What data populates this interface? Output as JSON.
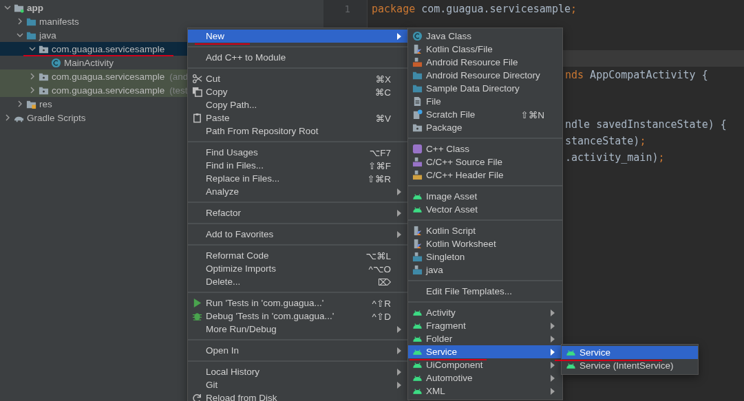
{
  "project_tree": [
    {
      "label": "app",
      "kind": "module",
      "expanded": true,
      "selected": false,
      "test": false,
      "underlined": false,
      "children": [
        {
          "label": "manifests",
          "kind": "folder",
          "expanded": false,
          "selected": false,
          "test": false,
          "underlined": false
        },
        {
          "label": "java",
          "kind": "folder",
          "expanded": true,
          "selected": false,
          "test": false,
          "underlined": false,
          "children": [
            {
              "label": "com.guagua.servicesample",
              "kind": "package",
              "expanded": true,
              "selected": true,
              "test": false,
              "underlined": true,
              "children": [
                {
                  "label": "MainActivity",
                  "kind": "java-class",
                  "selected": false,
                  "test": false,
                  "underlined": false
                }
              ]
            },
            {
              "label": "com.guagua.servicesample",
              "suffix": "(and",
              "kind": "package",
              "expanded": false,
              "selected": false,
              "test": true,
              "underlined": false
            },
            {
              "label": "com.guagua.servicesample",
              "suffix": "(test",
              "kind": "package",
              "expanded": false,
              "selected": false,
              "test": true,
              "underlined": false
            }
          ]
        },
        {
          "label": "res",
          "kind": "res-folder",
          "expanded": false,
          "selected": false,
          "test": false,
          "underlined": false
        }
      ]
    },
    {
      "label": "Gradle Scripts",
      "kind": "gradle",
      "expanded": false,
      "selected": false,
      "test": false,
      "underlined": false
    }
  ],
  "editor": {
    "lines": [
      {
        "number": "1",
        "kind": "full",
        "current": false,
        "tokens": [
          {
            "text": "package",
            "kind": "keyword"
          },
          {
            "text": " com.guagua.servicesample",
            "kind": "plain"
          },
          {
            "text": ";",
            "kind": "keyword"
          }
        ]
      },
      {
        "kind": "full",
        "current": false
      },
      {
        "kind": "covered",
        "current": false
      },
      {
        "kind": "covered",
        "current": true
      },
      {
        "kind": "covered",
        "current": false,
        "tokens": [
          {
            "text": "nds",
            "kind": "keyword"
          },
          {
            "text": " AppCompatActivity {",
            "kind": "plain"
          }
        ]
      },
      {
        "kind": "covered",
        "current": false
      },
      {
        "kind": "covered",
        "current": false
      },
      {
        "kind": "covered",
        "current": false,
        "tokens": [
          {
            "text": "ndle savedInstanceState) {",
            "kind": "plain"
          }
        ]
      },
      {
        "kind": "covered",
        "current": false,
        "tokens": [
          {
            "text": "stanceState)",
            "kind": "plain"
          },
          {
            "text": ";",
            "kind": "keyword"
          }
        ]
      },
      {
        "kind": "covered",
        "current": false,
        "tokens": [
          {
            "text": ".activity_main)",
            "kind": "plain"
          },
          {
            "text": ";",
            "kind": "keyword"
          }
        ]
      }
    ]
  },
  "context_menu": [
    {
      "kind": "text",
      "label": "New",
      "submenu": true,
      "selected": true,
      "underlined": true
    },
    {
      "kind": "separator"
    },
    {
      "kind": "text",
      "label": "Add C++ to Module",
      "submenu": false,
      "selected": false,
      "underlined": false
    },
    {
      "kind": "separator"
    },
    {
      "kind": "scissors",
      "label": "Cut",
      "shortcut": "⌘X",
      "submenu": false,
      "selected": false,
      "underlined": false
    },
    {
      "kind": "copy",
      "label": "Copy",
      "shortcut": "⌘C",
      "submenu": false,
      "selected": false,
      "underlined": false
    },
    {
      "kind": "text",
      "label": "Copy Path...",
      "submenu": false,
      "selected": false,
      "underlined": false
    },
    {
      "kind": "paste",
      "label": "Paste",
      "shortcut": "⌘V",
      "submenu": false,
      "selected": false,
      "underlined": false
    },
    {
      "kind": "text",
      "label": "Path From Repository Root",
      "submenu": false,
      "selected": false,
      "underlined": false
    },
    {
      "kind": "separator"
    },
    {
      "kind": "text",
      "label": "Find Usages",
      "shortcut": "⌥F7",
      "submenu": false,
      "selected": false,
      "underlined": false
    },
    {
      "kind": "text",
      "label": "Find in Files...",
      "shortcut": "⇧⌘F",
      "submenu": false,
      "selected": false,
      "underlined": false
    },
    {
      "kind": "text",
      "label": "Replace in Files...",
      "shortcut": "⇧⌘R",
      "submenu": false,
      "selected": false,
      "underlined": false
    },
    {
      "kind": "text",
      "label": "Analyze",
      "submenu": true,
      "selected": false,
      "underlined": false
    },
    {
      "kind": "separator"
    },
    {
      "kind": "text",
      "label": "Refactor",
      "submenu": true,
      "selected": false,
      "underlined": false
    },
    {
      "kind": "separator"
    },
    {
      "kind": "text",
      "label": "Add to Favorites",
      "submenu": true,
      "selected": false,
      "underlined": false
    },
    {
      "kind": "separator"
    },
    {
      "kind": "text",
      "label": "Reformat Code",
      "shortcut": "⌥⌘L",
      "submenu": false,
      "selected": false,
      "underlined": false
    },
    {
      "kind": "text",
      "label": "Optimize Imports",
      "shortcut": "^⌥O",
      "submenu": false,
      "selected": false,
      "underlined": false
    },
    {
      "kind": "text",
      "label": "Delete...",
      "shortcut": "⌦",
      "submenu": false,
      "selected": false,
      "underlined": false
    },
    {
      "kind": "separator"
    },
    {
      "kind": "run",
      "label": "Run 'Tests in 'com.guagua...'",
      "shortcut": "^⇧R",
      "submenu": false,
      "selected": false,
      "underlined": false
    },
    {
      "kind": "debug",
      "label": "Debug 'Tests in 'com.guagua...'",
      "shortcut": "^⇧D",
      "submenu": false,
      "selected": false,
      "underlined": false
    },
    {
      "kind": "text",
      "label": "More Run/Debug",
      "submenu": true,
      "selected": false,
      "underlined": false
    },
    {
      "kind": "separator"
    },
    {
      "kind": "text",
      "label": "Open In",
      "submenu": true,
      "selected": false,
      "underlined": false
    },
    {
      "kind": "separator"
    },
    {
      "kind": "text",
      "label": "Local History",
      "submenu": true,
      "selected": false,
      "underlined": false
    },
    {
      "kind": "text",
      "label": "Git",
      "submenu": true,
      "selected": false,
      "underlined": false
    },
    {
      "kind": "reload",
      "label": "Reload from Disk",
      "submenu": false,
      "selected": false,
      "underlined": false
    }
  ],
  "new_submenu": [
    {
      "kind": "java-class",
      "label": "Java Class",
      "submenu": false,
      "selected": false,
      "underlined": false
    },
    {
      "kind": "kotlin-file",
      "label": "Kotlin Class/File",
      "submenu": false,
      "selected": false,
      "underlined": false
    },
    {
      "kind": "resource-file",
      "label": "Android Resource File",
      "submenu": false,
      "selected": false,
      "underlined": false
    },
    {
      "kind": "folder",
      "label": "Android Resource Directory",
      "submenu": false,
      "selected": false,
      "underlined": false
    },
    {
      "kind": "folder",
      "label": "Sample Data Directory",
      "submenu": false,
      "selected": false,
      "underlined": false
    },
    {
      "kind": "file",
      "label": "File",
      "submenu": false,
      "selected": false,
      "underlined": false
    },
    {
      "kind": "scratch",
      "label": "Scratch File",
      "shortcut": "⇧⌘N",
      "submenu": false,
      "selected": false,
      "underlined": false
    },
    {
      "kind": "package",
      "label": "Package",
      "submenu": false,
      "selected": false,
      "underlined": false
    },
    {
      "kind": "separator"
    },
    {
      "kind": "cpp-class",
      "label": "C++ Class",
      "submenu": false,
      "selected": false,
      "underlined": false
    },
    {
      "kind": "cpp-source",
      "label": "C/C++ Source File",
      "submenu": false,
      "selected": false,
      "underlined": false
    },
    {
      "kind": "cpp-header",
      "label": "C/C++ Header File",
      "submenu": false,
      "selected": false,
      "underlined": false
    },
    {
      "kind": "separator"
    },
    {
      "kind": "android",
      "label": "Image Asset",
      "submenu": false,
      "selected": false,
      "underlined": false
    },
    {
      "kind": "android",
      "label": "Vector Asset",
      "submenu": false,
      "selected": false,
      "underlined": false
    },
    {
      "kind": "separator"
    },
    {
      "kind": "kotlin-file",
      "label": "Kotlin Script",
      "submenu": false,
      "selected": false,
      "underlined": false
    },
    {
      "kind": "kotlin-file",
      "label": "Kotlin Worksheet",
      "submenu": false,
      "selected": false,
      "underlined": false
    },
    {
      "kind": "java-template",
      "label": "Singleton",
      "submenu": false,
      "selected": false,
      "underlined": false
    },
    {
      "kind": "java-template",
      "label": "java",
      "submenu": false,
      "selected": false,
      "underlined": false
    },
    {
      "kind": "separator"
    },
    {
      "kind": "text",
      "label": "Edit File Templates...",
      "submenu": false,
      "selected": false,
      "underlined": false
    },
    {
      "kind": "separator"
    },
    {
      "kind": "android",
      "label": "Activity",
      "submenu": true,
      "selected": false,
      "underlined": false
    },
    {
      "kind": "android",
      "label": "Fragment",
      "submenu": true,
      "selected": false,
      "underlined": false
    },
    {
      "kind": "android",
      "label": "Folder",
      "submenu": true,
      "selected": false,
      "underlined": false
    },
    {
      "kind": "android",
      "label": "Service",
      "submenu": true,
      "selected": true,
      "underlined": true
    },
    {
      "kind": "android",
      "label": "UiComponent",
      "submenu": true,
      "selected": false,
      "underlined": false
    },
    {
      "kind": "android",
      "label": "Automotive",
      "submenu": true,
      "selected": false,
      "underlined": false
    },
    {
      "kind": "android",
      "label": "XML",
      "submenu": true,
      "selected": false,
      "underlined": false
    }
  ],
  "service_submenu": [
    {
      "kind": "android",
      "label": "Service",
      "submenu": false,
      "selected": true,
      "underlined": true
    },
    {
      "kind": "android",
      "label": "Service (IntentService)",
      "submenu": false,
      "selected": false,
      "underlined": false
    }
  ]
}
